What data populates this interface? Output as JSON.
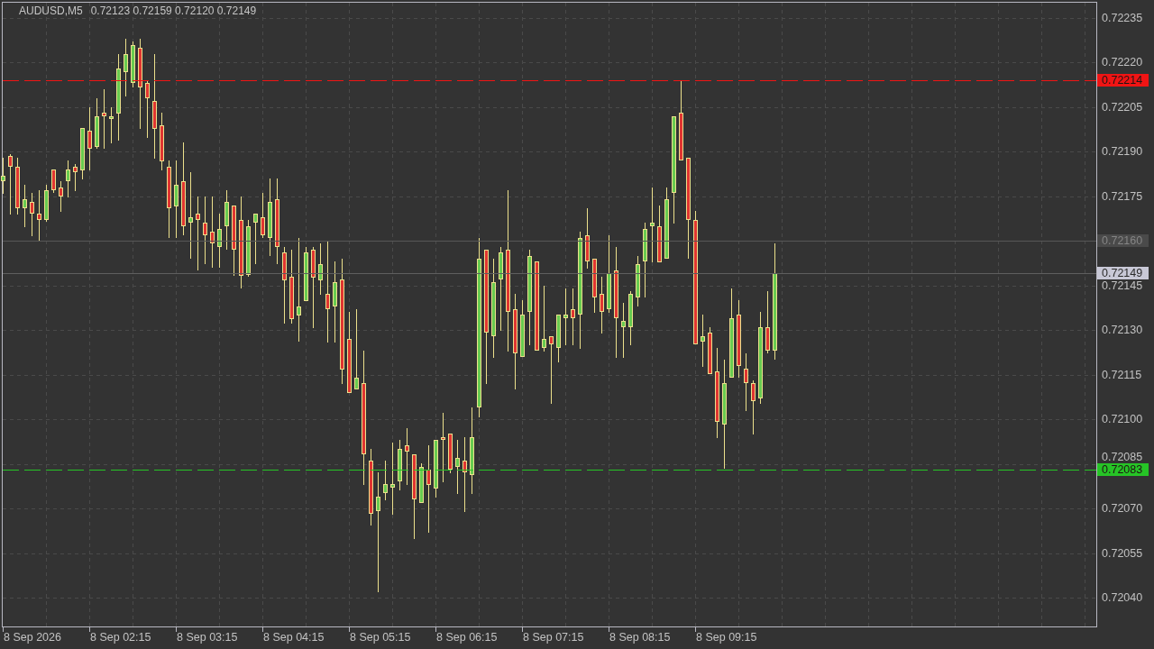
{
  "chart": {
    "symbol": "AUDUSD,M5",
    "ohlc": "0.72123 0.72159 0.72120 0.72149"
  },
  "price_axis": {
    "labels": [
      "0.72235",
      "0.72220",
      "0.72205",
      "0.72190",
      "0.72175",
      "0.72145",
      "0.72130",
      "0.72115",
      "0.72100",
      "0.72085",
      "0.72070",
      "0.72055",
      "0.72040"
    ]
  },
  "price_lines": [
    {
      "label": "0.72214",
      "kind": "level",
      "color": "#f01414"
    },
    {
      "label": "0.72160",
      "kind": "ask",
      "color": "#4a4a4a"
    },
    {
      "label": "0.72149",
      "kind": "bid",
      "color": "#c8c8d6"
    },
    {
      "label": "0.72083",
      "kind": "level",
      "color": "#26c426"
    }
  ],
  "time_axis": {
    "labels": [
      "8 Sep 2026",
      "8 Sep 02:15",
      "8 Sep 03:15",
      "8 Sep 04:15",
      "8 Sep 05:15",
      "8 Sep 06:15",
      "8 Sep 07:15",
      "8 Sep 08:15",
      "8 Sep 09:15"
    ]
  }
}
